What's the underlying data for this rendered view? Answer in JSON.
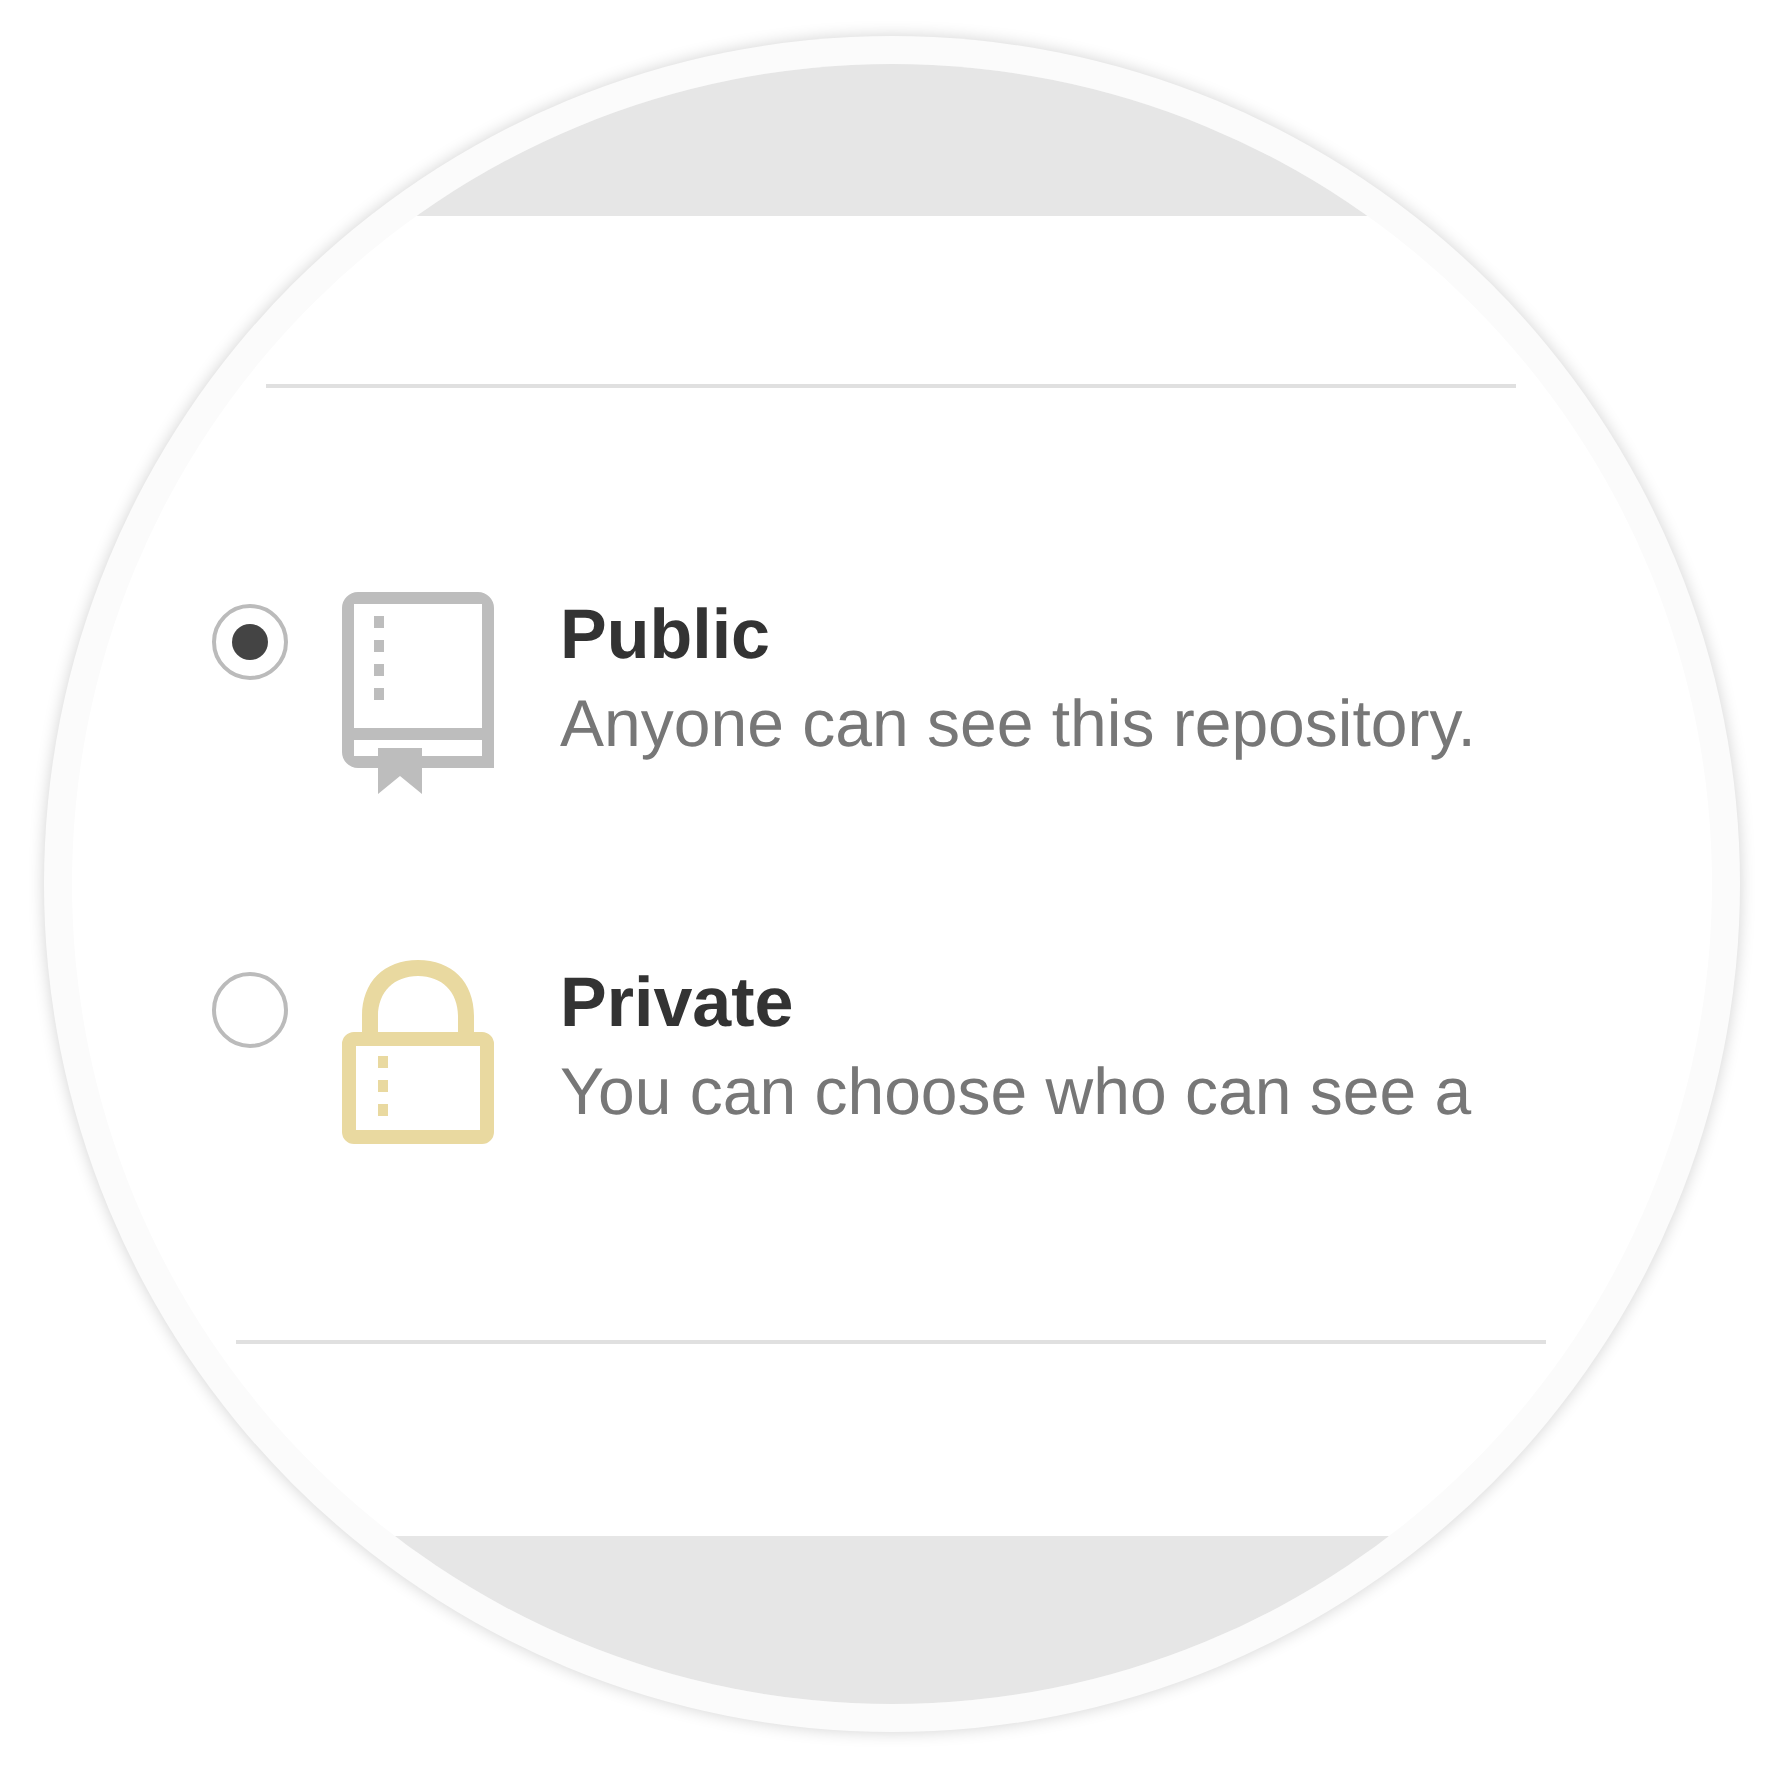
{
  "options": [
    {
      "kind": "book",
      "title": "Public",
      "description": "Anyone can see this repository.",
      "selected": true
    },
    {
      "kind": "lock",
      "title": "Private",
      "description": "You can choose who can see a",
      "selected": false
    }
  ]
}
